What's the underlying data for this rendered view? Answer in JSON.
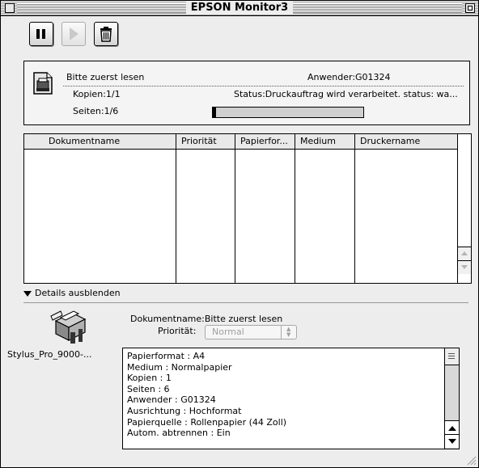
{
  "window": {
    "title": "EPSON Monitor3"
  },
  "toolbar": {
    "pause": {
      "icon": "pause-icon"
    },
    "resume": {
      "icon": "play-icon",
      "enabled": false
    },
    "delete": {
      "icon": "trash-icon"
    }
  },
  "job": {
    "document": "Bitte zuerst lesen",
    "user_label": "Anwender",
    "user": "G01324",
    "copies_label": "Kopien",
    "copies": "1/1",
    "pages_label": "Seiten",
    "pages": "1/6",
    "status_label": "Status",
    "status": "Druckauftrag wird verarbeitet. status: wa...",
    "progress": 0.02
  },
  "queue_table": {
    "columns": [
      "Dokumentname",
      "Priorität",
      "Papierfor...",
      "Medium",
      "Druckername"
    ],
    "rows": []
  },
  "details": {
    "toggle_label": "Details ausblenden",
    "printer_name": "Stylus_Pro_9000-...",
    "document_label": "Dokumentname",
    "document": "Bitte zuerst lesen",
    "priority_label": "Priorität",
    "priority_value": "Normal",
    "properties": [
      "Papierformat : A4",
      "Medium : Normalpapier",
      "Kopien : 1",
      "Seiten : 6",
      "Anwender : G01324",
      "Ausrichtung : Hochformat",
      "Papierquelle : Rollenpapier (44 Zoll)",
      "Autom. abtrennen : Ein"
    ]
  },
  "colors": {
    "window_bg": "#ededed",
    "panel_bg": "#ffffff",
    "border": "#000000"
  }
}
